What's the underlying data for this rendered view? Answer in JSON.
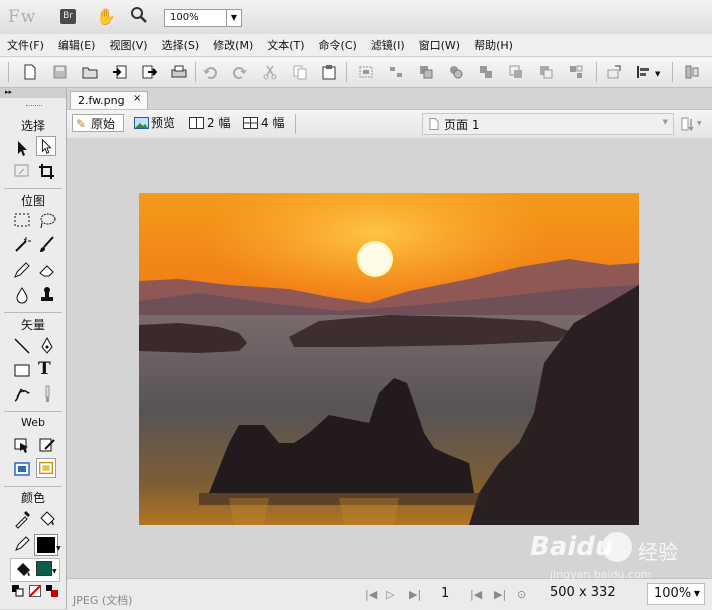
{
  "app": {
    "logo": "Fw",
    "bridge_label": "Br",
    "zoom_value": "100%"
  },
  "menu": [
    "文件(F)",
    "编辑(E)",
    "视图(V)",
    "选择(S)",
    "修改(M)",
    "文本(T)",
    "命令(C)",
    "滤镜(I)",
    "窗口(W)",
    "帮助(H)"
  ],
  "tools": {
    "sections": [
      "选择",
      "位图",
      "矢量",
      "Web",
      "颜色"
    ],
    "text_tool_label": "T"
  },
  "document": {
    "tab_name": "2.fw.png",
    "close_label": "×"
  },
  "viewbar": {
    "original": "原始",
    "preview": "预览",
    "two_up": "2 幅",
    "four_up": "4 幅",
    "page": "页面 1"
  },
  "status": {
    "format": "JPEG (文档)",
    "page_number": "1",
    "size": "500 x 332",
    "zoom": "100%"
  },
  "watermark": {
    "brand": "Baidu",
    "brand_cn": "经验",
    "url": "jingyan.baidu.com"
  },
  "colors": {
    "stroke": "#000000",
    "fill": "#0a5e4a",
    "sunset_top": "#f28a10",
    "sea": "#5f5a5c"
  }
}
